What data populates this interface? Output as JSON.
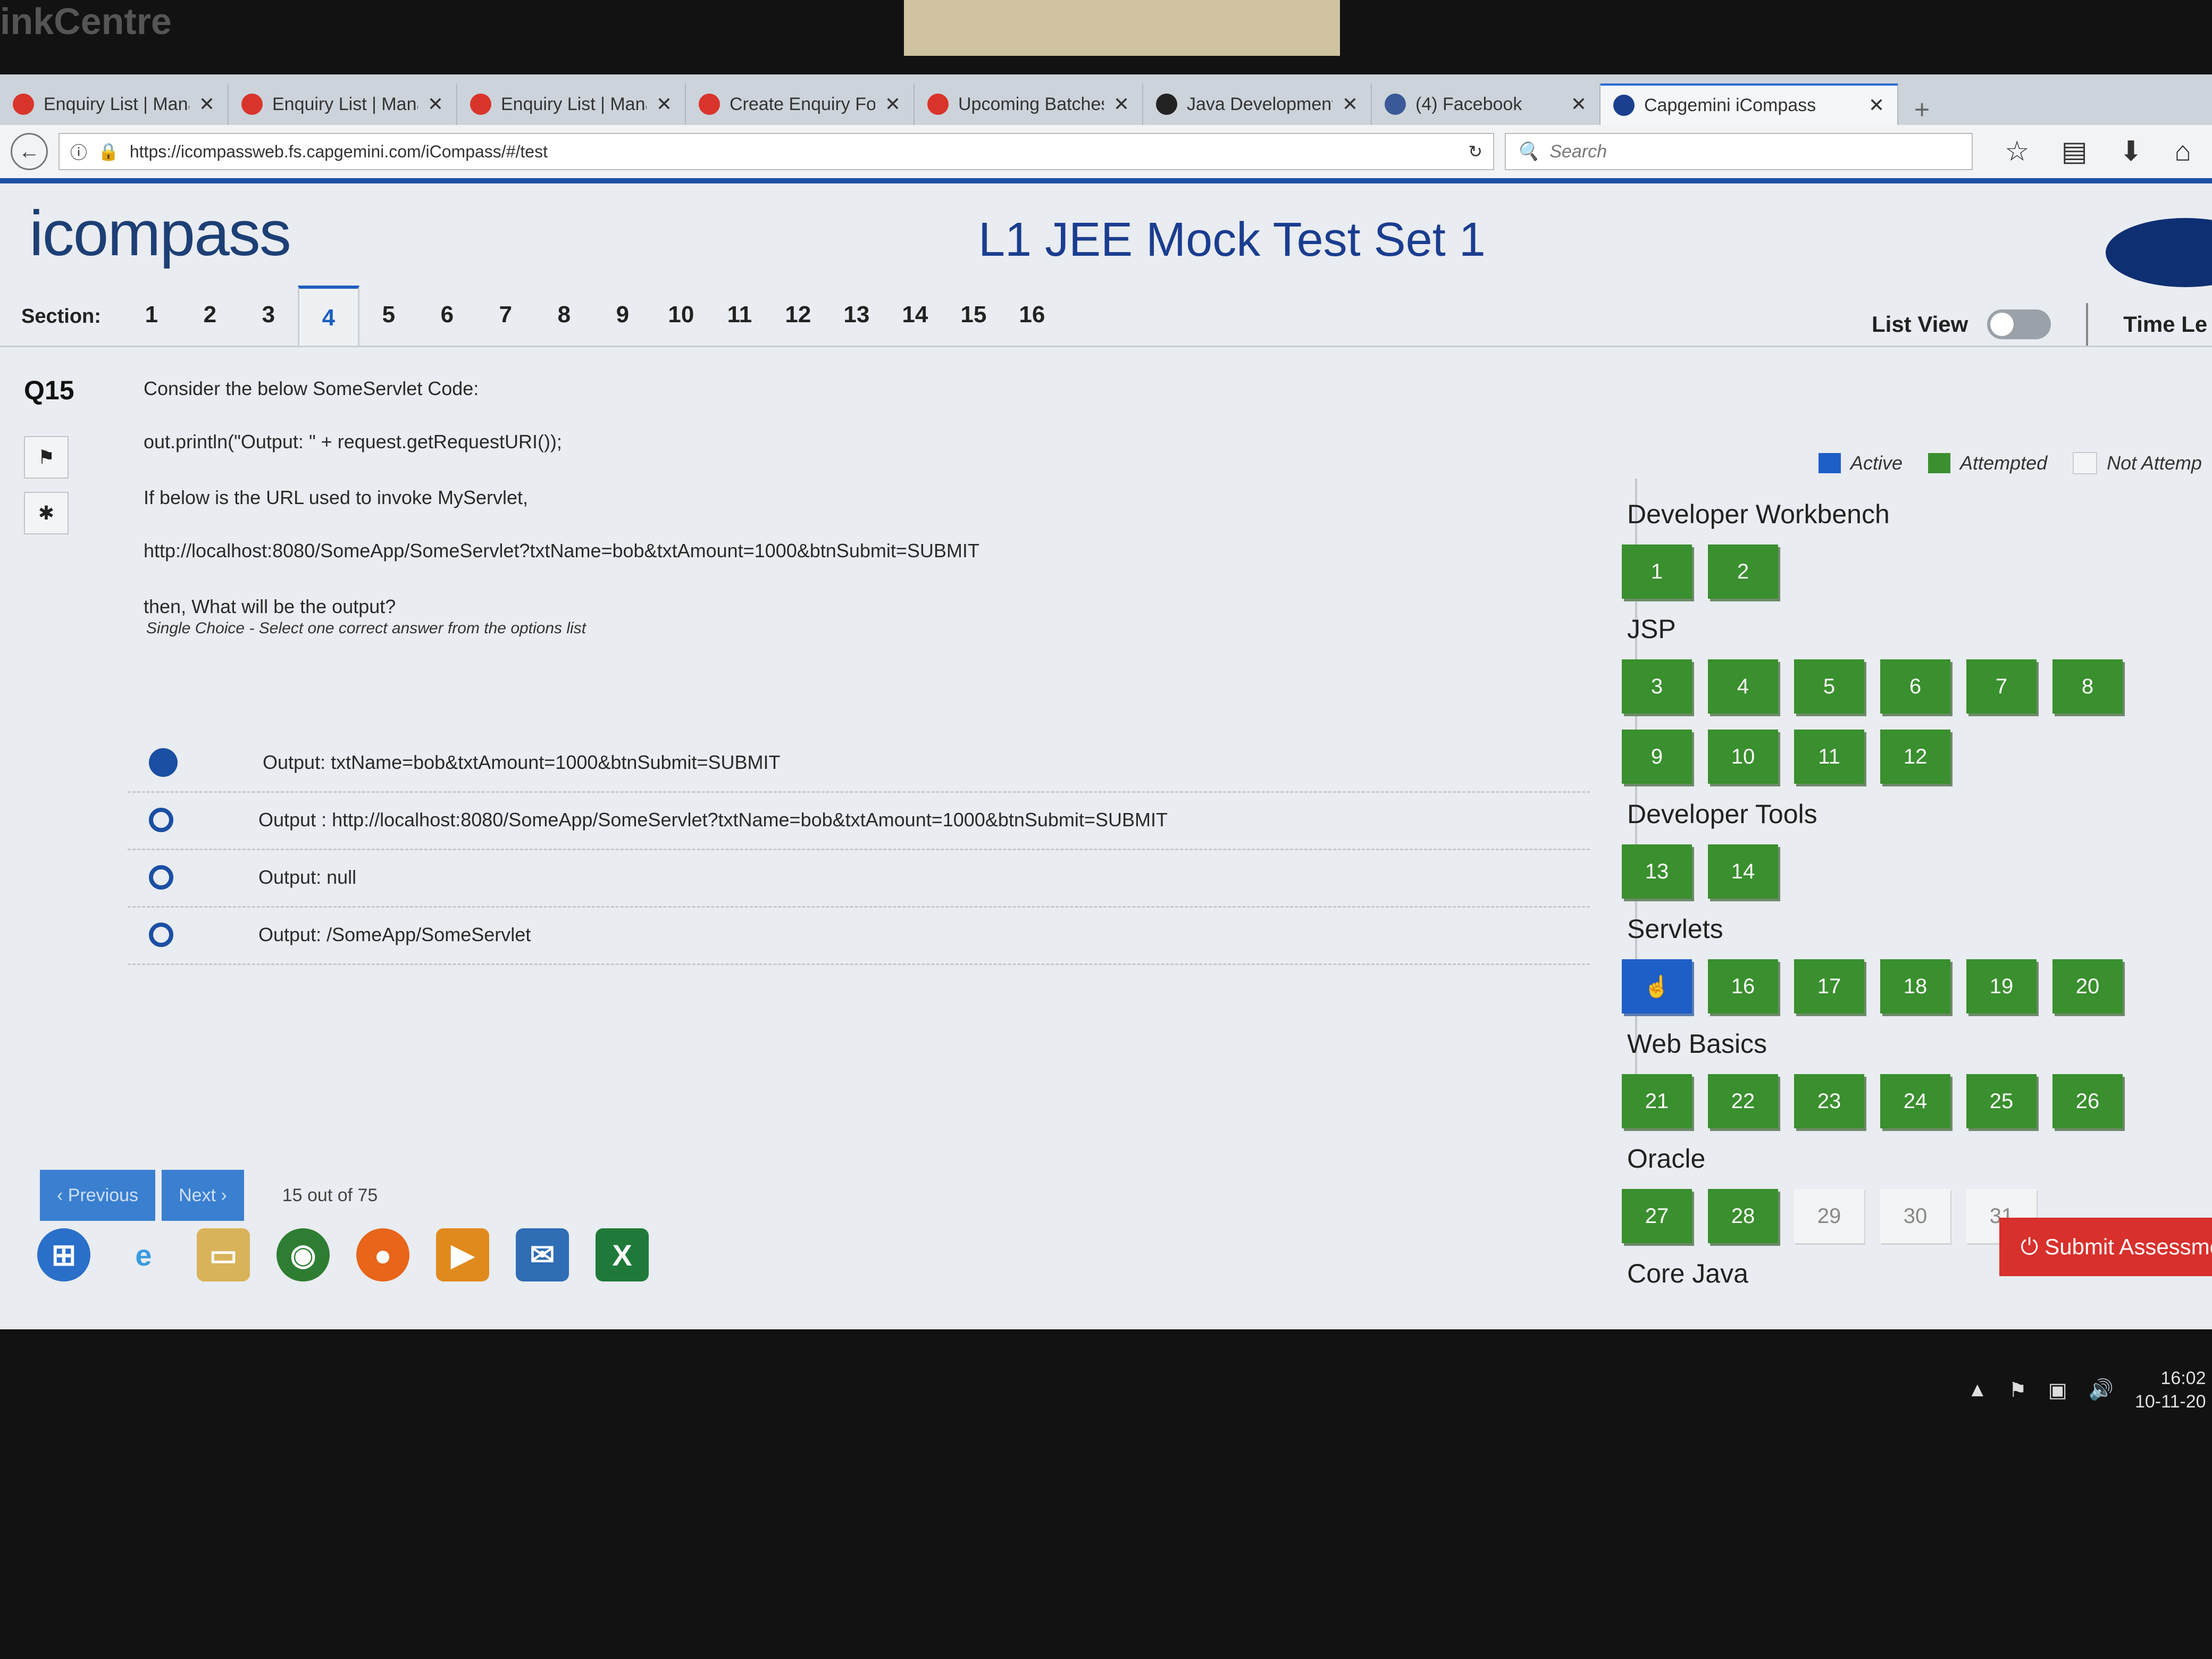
{
  "bezel_brand": "inkCentre",
  "browser": {
    "tabs": [
      {
        "title": "Enquiry List | Manager",
        "color": "#d9342b"
      },
      {
        "title": "Enquiry List | Manager",
        "color": "#d9342b"
      },
      {
        "title": "Enquiry List | Manager",
        "color": "#d9342b"
      },
      {
        "title": "Create Enquiry Form | ",
        "color": "#d9342b"
      },
      {
        "title": "Upcoming Batches - E",
        "color": "#d9342b"
      },
      {
        "title": "Java Development Trai",
        "color": "#222222"
      },
      {
        "title": "(4) Facebook",
        "color": "#3b5998"
      },
      {
        "title": "Capgemini iCompass",
        "color": "#1b3f8f"
      }
    ],
    "url": "https://icompassweb.fs.capgemini.com/iCompass/#/test",
    "search_placeholder": "Search"
  },
  "app": {
    "logo": "icompass",
    "title": "L1 JEE Mock Test Set 1",
    "section_label": "Section:",
    "sections": [
      "1",
      "2",
      "3",
      "4",
      "5",
      "6",
      "7",
      "8",
      "9",
      "10",
      "11",
      "12",
      "13",
      "14",
      "15",
      "16"
    ],
    "active_section": "4",
    "list_view_label": "List View",
    "list_view_on": false,
    "time_left_label": "Time Le"
  },
  "question": {
    "number": "Q15",
    "lines": [
      "Consider the below SomeServlet Code:",
      "out.println(\"Output: \" + request.getRequestURI());",
      "If below is the URL used to invoke MyServlet,",
      "http://localhost:8080/SomeApp/SomeServlet?txtName=bob&txtAmount=1000&btnSubmit=SUBMIT",
      "then, What will be the output?"
    ],
    "hint": "Single Choice - Select one correct answer from the options list",
    "options": [
      {
        "text": "Output: txtName=bob&txtAmount=1000&btnSubmit=SUBMIT",
        "selected": true
      },
      {
        "text": "Output : http://localhost:8080/SomeApp/SomeServlet?txtName=bob&txtAmount=1000&btnSubmit=SUBMIT",
        "selected": false
      },
      {
        "text": "Output: null",
        "selected": false
      },
      {
        "text": "Output: /SomeApp/SomeServlet",
        "selected": false
      }
    ]
  },
  "legend": {
    "active": "Active",
    "attempted": "Attempted",
    "not_attempted": "Not Attemp",
    "colors": {
      "active": "#1e5ec7",
      "attempted": "#3a8f2e",
      "not_attempted": "#f3f4f5"
    }
  },
  "palette": [
    {
      "title": "Developer Workbench",
      "questions": [
        {
          "n": "1",
          "s": "attempted"
        },
        {
          "n": "2",
          "s": "attempted"
        }
      ]
    },
    {
      "title": "JSP",
      "questions": [
        {
          "n": "3",
          "s": "attempted"
        },
        {
          "n": "4",
          "s": "attempted"
        },
        {
          "n": "5",
          "s": "attempted"
        },
        {
          "n": "6",
          "s": "attempted"
        },
        {
          "n": "7",
          "s": "attempted"
        },
        {
          "n": "8",
          "s": "attempted"
        },
        {
          "n": "9",
          "s": "attempted"
        },
        {
          "n": "10",
          "s": "attempted"
        },
        {
          "n": "11",
          "s": "attempted"
        },
        {
          "n": "12",
          "s": "attempted"
        }
      ]
    },
    {
      "title": "Developer Tools",
      "questions": [
        {
          "n": "13",
          "s": "attempted"
        },
        {
          "n": "14",
          "s": "attempted"
        }
      ]
    },
    {
      "title": "Servlets",
      "questions": [
        {
          "n": "",
          "s": "active"
        },
        {
          "n": "16",
          "s": "attempted"
        },
        {
          "n": "17",
          "s": "attempted"
        },
        {
          "n": "18",
          "s": "attempted"
        },
        {
          "n": "19",
          "s": "attempted"
        },
        {
          "n": "20",
          "s": "attempted"
        }
      ]
    },
    {
      "title": "Web Basics",
      "questions": [
        {
          "n": "21",
          "s": "attempted"
        },
        {
          "n": "22",
          "s": "attempted"
        },
        {
          "n": "23",
          "s": "attempted"
        },
        {
          "n": "24",
          "s": "attempted"
        },
        {
          "n": "25",
          "s": "attempted"
        },
        {
          "n": "26",
          "s": "attempted"
        }
      ]
    },
    {
      "title": "Oracle",
      "questions": [
        {
          "n": "27",
          "s": "attempted"
        },
        {
          "n": "28",
          "s": "attempted"
        },
        {
          "n": "29",
          "s": "na"
        },
        {
          "n": "30",
          "s": "na"
        },
        {
          "n": "31",
          "s": "na"
        }
      ]
    },
    {
      "title": "Core Java",
      "questions": []
    }
  ],
  "footer": {
    "previous": "‹ Previous",
    "next": "Next ›",
    "count": "15 out of 75",
    "submit": "Submit Assessme"
  },
  "tray": {
    "time": "16:02",
    "date": "10-11-20"
  }
}
